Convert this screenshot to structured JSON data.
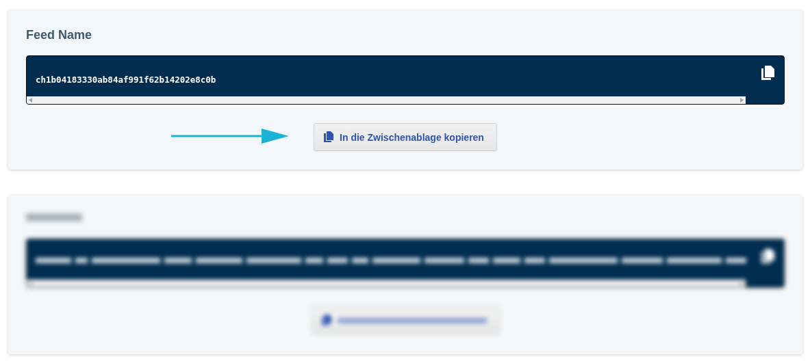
{
  "cards": [
    {
      "blurred": false,
      "title": "Feed Name",
      "code": {
        "value": "ch1b04183330ab84af991f62b14202e8c0b"
      },
      "pointer_arrow": true,
      "button": {
        "label": "In die Zwischenablage kopieren"
      }
    },
    {
      "blurred": true,
      "pointer_arrow": false
    }
  ]
}
